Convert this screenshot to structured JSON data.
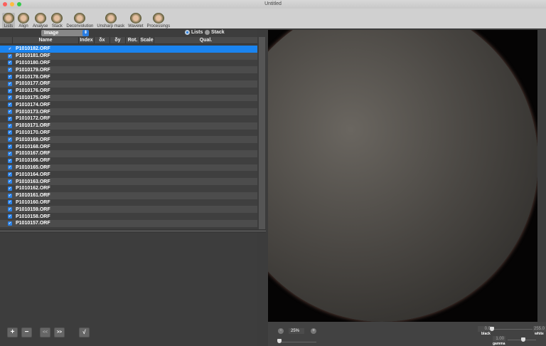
{
  "window": {
    "title": "Untitled"
  },
  "toolbar": [
    {
      "label": "Lists",
      "icon": "lists-icon",
      "active": true
    },
    {
      "label": "Align",
      "icon": "align-icon"
    },
    {
      "label": "Analyse",
      "icon": "analyse-icon"
    },
    {
      "label": "Stack",
      "icon": "stack-icon"
    },
    {
      "label": "Deconvolution",
      "icon": "deconvolution-icon"
    },
    {
      "label": "Unsharp mask",
      "icon": "unsharp-mask-icon"
    },
    {
      "label": "Wavelet",
      "icon": "wavelet-icon"
    },
    {
      "label": "Processings",
      "icon": "processings-icon"
    }
  ],
  "list": {
    "type_select": "Image",
    "radio_lists": "Lists",
    "radio_stack": "Stack",
    "selected_mode": "Lists",
    "columns": [
      "Name",
      "Index",
      "δx",
      "δy",
      "Rot.",
      "Scale",
      "Qual."
    ],
    "files": [
      "P1010182.ORF",
      "P1010181.ORF",
      "P1010180.ORF",
      "P1010179.ORF",
      "P1010178.ORF",
      "P1010177.ORF",
      "P1010176.ORF",
      "P1010175.ORF",
      "P1010174.ORF",
      "P1010173.ORF",
      "P1010172.ORF",
      "P1010171.ORF",
      "P1010170.ORF",
      "P1010169.ORF",
      "P1010168.ORF",
      "P1010167.ORF",
      "P1010166.ORF",
      "P1010165.ORF",
      "P1010164.ORF",
      "P1010163.ORF",
      "P1010162.ORF",
      "P1010161.ORF",
      "P1010160.ORF",
      "P1010159.ORF",
      "P1010158.ORF",
      "P1010157.ORF"
    ],
    "selected": "P1010182.ORF"
  },
  "buttons": {
    "add": "+",
    "remove": "−",
    "prev": "<<",
    "next": ">>",
    "check": "√"
  },
  "viewer": {
    "zoom": "25%",
    "black_value": "0.0",
    "white_value": "255.0",
    "gamma_value": "1.00",
    "black_label": "black",
    "white_label": "white",
    "gamma_label": "gamma"
  },
  "colors": {
    "accent": "#1a84f0"
  }
}
